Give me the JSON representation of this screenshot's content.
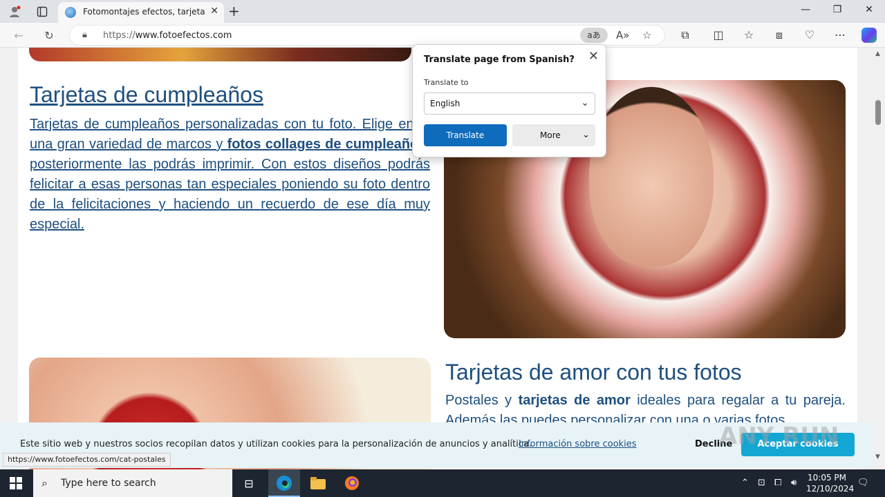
{
  "browser": {
    "tab_title": "Fotomontajes efectos, tarjetas de",
    "url_prefix": "https://",
    "url_host": "www.fotoefectos.com",
    "translate_glyph": "aあ",
    "status_url": "https://www.fotoefectos.com/cat-postales"
  },
  "page": {
    "section1": {
      "heading": "Tarjetas de cumpleaños",
      "p1": "Tarjetas de cumpleaños personalizadas con tu foto. Elige entre una gran variedad de marcos y ",
      "b1": "fotos collages de cumpleaños",
      "p2": ", posteriormente las podrás imprimir. Con estos diseños podrás felicitar a esas personas tan especiales poniendo su foto dentro de la felicitaciones y haciendo un recuerdo de ese día muy especial."
    },
    "section2": {
      "heading": "Tarjetas de amor con tus fotos",
      "p1": "Postales y ",
      "b1": "tarjetas de amor",
      "p2": " ideales para regalar a tu pareja. Además las puedes personalizar con una o varias fotos"
    }
  },
  "translate_popup": {
    "title": "Translate page from Spanish?",
    "label": "Translate to",
    "selected_language": "English",
    "translate_button": "Translate",
    "more_button": "More"
  },
  "cookie_banner": {
    "text": "Este sitio web y nuestros socios recopilan datos y utilizan cookies para la personalización de anuncios y analítica.",
    "link": "Información sobre cookies",
    "decline": "Decline",
    "accept": "Aceptar cookies"
  },
  "watermark": "ANY RUN",
  "taskbar": {
    "search_placeholder": "Type here to search",
    "time": "10:05 PM",
    "date": "12/10/2024"
  }
}
